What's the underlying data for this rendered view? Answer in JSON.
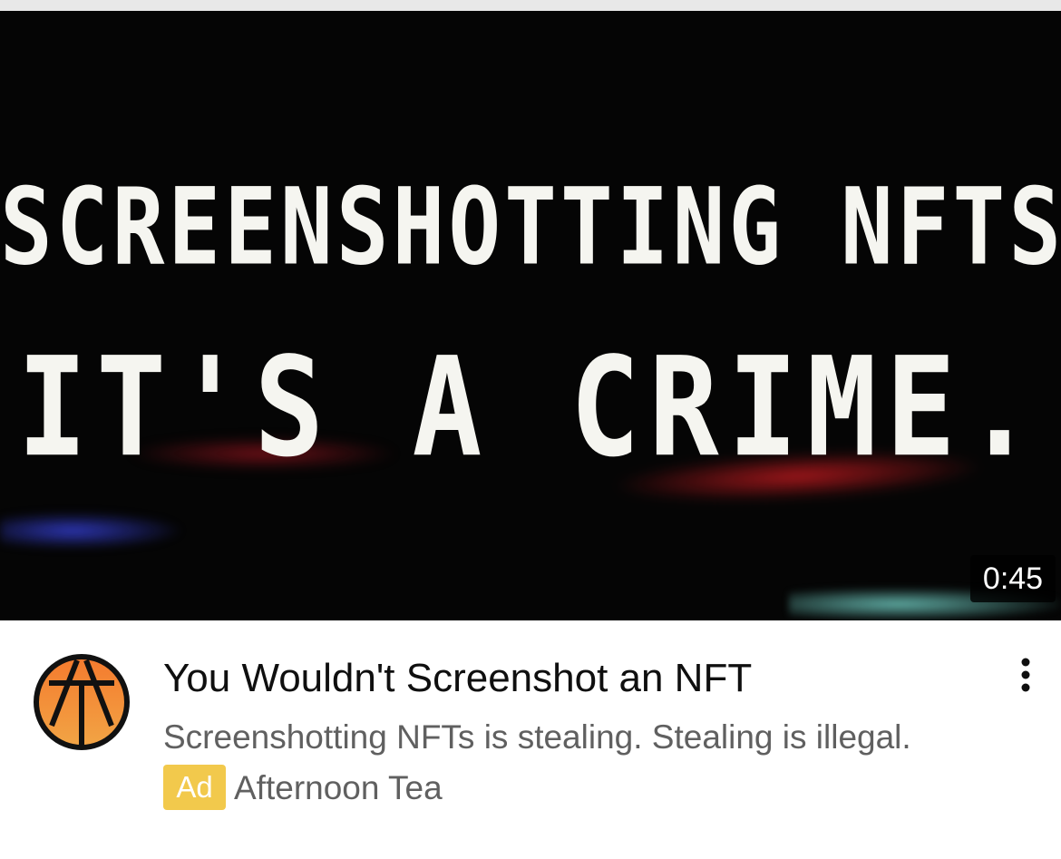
{
  "video": {
    "thumbnail_line_1": "SCREENSHOTTING NFTS",
    "thumbnail_line_2": "IT'S A CRIME.",
    "duration": "0:45",
    "title": "You Wouldn't Screenshot an NFT",
    "description": "Screenshotting NFTs is stealing. Stealing is illegal."
  },
  "ad": {
    "badge_label": "Ad",
    "advertiser": "Afternoon Tea",
    "badge_color": "#f2c94c"
  },
  "icons": {
    "avatar": "afternoon-tea-logo-icon",
    "menu": "more-vertical-icon"
  },
  "colors": {
    "avatar_fill": "#f08a3a",
    "title_text": "#0f0f0f",
    "secondary_text": "#606060"
  }
}
